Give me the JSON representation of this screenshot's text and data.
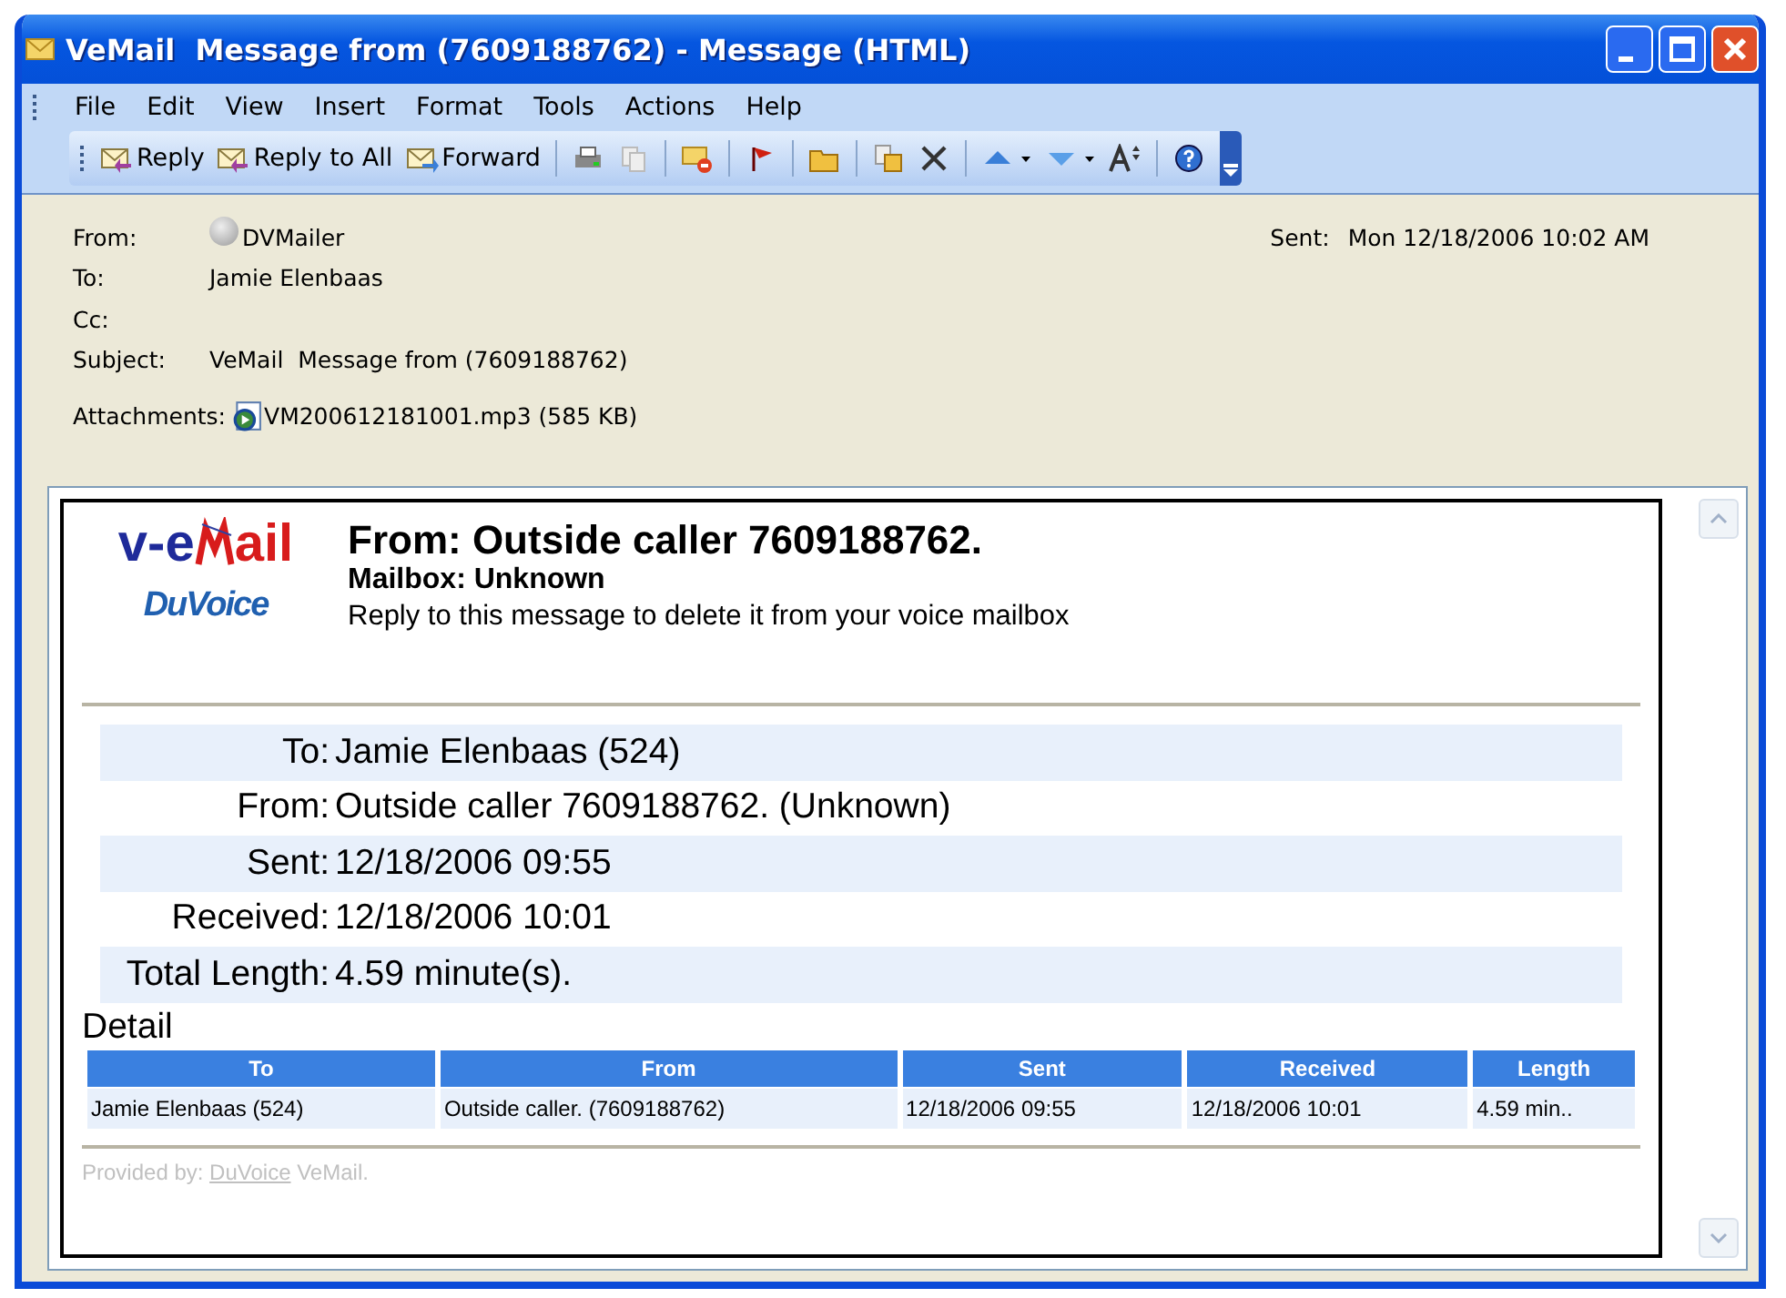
{
  "window": {
    "title": "VeMail  Message from (7609188762) - Message (HTML)"
  },
  "menu": [
    "File",
    "Edit",
    "View",
    "Insert",
    "Format",
    "Tools",
    "Actions",
    "Help"
  ],
  "toolbar": [
    {
      "kind": "reply",
      "label": "Reply"
    },
    {
      "kind": "reply-all",
      "label": "Reply to All"
    },
    {
      "kind": "forward",
      "label": "Forward"
    },
    {
      "kind": "sep"
    },
    {
      "kind": "print"
    },
    {
      "kind": "copy"
    },
    {
      "kind": "sep"
    },
    {
      "kind": "mail-delete"
    },
    {
      "kind": "sep"
    },
    {
      "kind": "flag"
    },
    {
      "kind": "sep"
    },
    {
      "kind": "folder"
    },
    {
      "kind": "sep"
    },
    {
      "kind": "paste"
    },
    {
      "kind": "delete"
    },
    {
      "kind": "sep"
    },
    {
      "kind": "up"
    },
    {
      "kind": "down"
    },
    {
      "kind": "font"
    },
    {
      "kind": "sep"
    },
    {
      "kind": "help"
    }
  ],
  "header": {
    "from_label": "From:",
    "from": "DVMailer",
    "to_label": "To:",
    "to": "Jamie Elenbaas",
    "cc_label": "Cc:",
    "subject_label": "Subject:",
    "subject": "VeMail  Message from (7609188762)",
    "sent_label": "Sent:",
    "sent": "Mon 12/18/2006 10:02 AM",
    "attachments_label": "Attachments:",
    "attachment": "VM200612181001.mp3 (585 KB)"
  },
  "message": {
    "logo": {
      "before": "v-e",
      "after": "ail",
      "brand": "DuVoice"
    },
    "title": "From: Outside caller 7609188762.",
    "mailbox": "Mailbox: Unknown",
    "note": "Reply to this message to delete it from your voice mailbox",
    "details": [
      {
        "label": "To:",
        "value": "Jamie Elenbaas (524)"
      },
      {
        "label": "From:",
        "value": "Outside caller 7609188762. (Unknown)"
      },
      {
        "label": "Sent:",
        "value": "12/18/2006 09:55"
      },
      {
        "label": "Received:",
        "value": "12/18/2006 10:01"
      },
      {
        "label": "Total Length:",
        "value": "4.59 minute(s)."
      }
    ],
    "detail_heading": "Detail",
    "table": {
      "columns": [
        "To",
        "From",
        "Sent",
        "Received",
        "Length"
      ],
      "rows": [
        [
          "Jamie Elenbaas (524)",
          "Outside caller. (7609188762)",
          "12/18/2006 09:55",
          "12/18/2006 10:01",
          "4.59 min.."
        ]
      ]
    },
    "footer": {
      "prefix": "Provided by:",
      "link": "DuVoice",
      "suffix": "VeMail."
    }
  }
}
